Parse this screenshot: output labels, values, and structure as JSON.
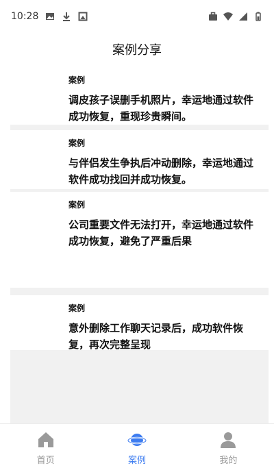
{
  "status_bar": {
    "time": "10:28",
    "left_icons": [
      "image-icon",
      "download-icon",
      "photo-icon"
    ],
    "right_icons": [
      "briefcase-icon",
      "wifi-icon",
      "signal-icon",
      "battery-icon"
    ]
  },
  "header": {
    "title": "案例分享"
  },
  "cases": [
    {
      "tag": "案例",
      "text": "调皮孩子误删手机照片，幸运地通过软件成功恢复，重现珍贵瞬间。"
    },
    {
      "tag": "案例",
      "text": "与伴侣发生争执后冲动删除，幸运地通过软件成功找回并成功恢复。"
    },
    {
      "tag": "案例",
      "text": "公司重要文件无法打开，幸运地通过软件成功恢复，避免了严重后果"
    },
    {
      "tag": "案例",
      "text": "意外删除工作聊天记录后，成功软件恢复，再次完整呈现"
    }
  ],
  "tabbar": {
    "items": [
      {
        "label": "首页",
        "icon": "home-icon",
        "active": false
      },
      {
        "label": "案例",
        "icon": "planet-icon",
        "active": true
      },
      {
        "label": "我的",
        "icon": "user-icon",
        "active": false
      }
    ],
    "colors": {
      "active": "#3d7cf0",
      "inactive": "#9a9a9a"
    }
  }
}
